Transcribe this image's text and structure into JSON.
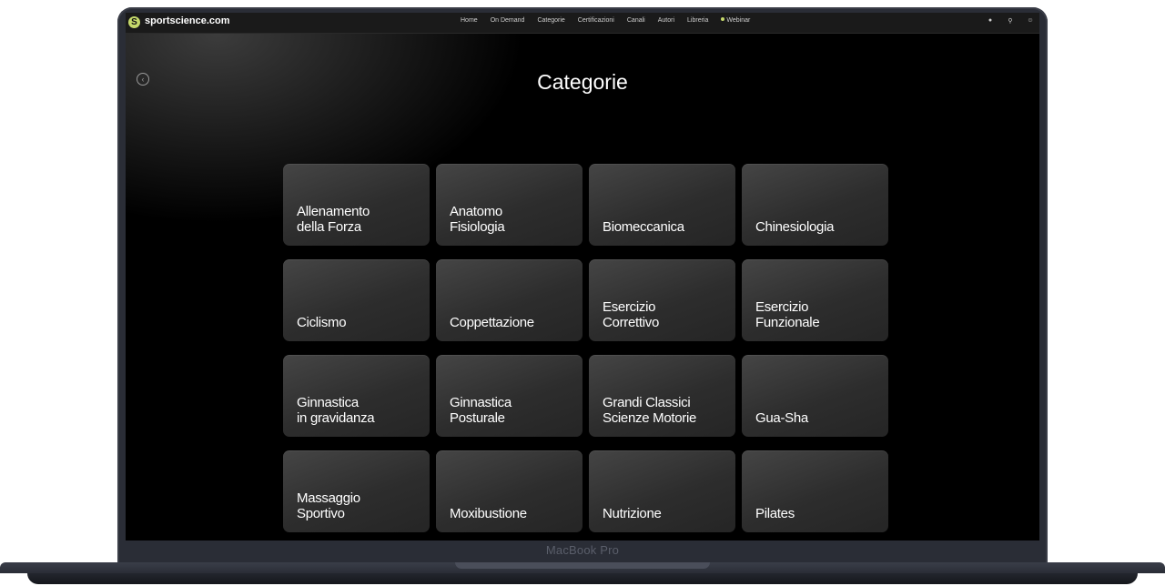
{
  "device_label": "MacBook Pro",
  "nav": {
    "brand": "sportscience.com",
    "logo_letter": "S",
    "items": [
      "Home",
      "On Demand",
      "Categorie",
      "Certificazioni",
      "Canali",
      "Autori",
      "Libreria",
      "Webinar"
    ],
    "icons": [
      "bell-icon",
      "search-icon",
      "user-icon"
    ]
  },
  "page": {
    "title": "Categorie"
  },
  "categories": [
    "Allenamento\ndella Forza",
    "Anatomo\nFisiologia",
    "Biomeccanica",
    "Chinesiologia",
    "Ciclismo",
    "Coppettazione",
    "Esercizio\nCorrettivo",
    "Esercizio\nFunzionale",
    "Ginnastica\nin gravidanza",
    "Ginnastica\nPosturale",
    "Grandi Classici\nScienze Motorie",
    "Gua-Sha",
    "Massaggio\nSportivo",
    "Moxibustione",
    "Nutrizione",
    "Pilates"
  ],
  "colors": {
    "accent": "#c5d96b",
    "background": "#000000",
    "card": "#333333"
  }
}
